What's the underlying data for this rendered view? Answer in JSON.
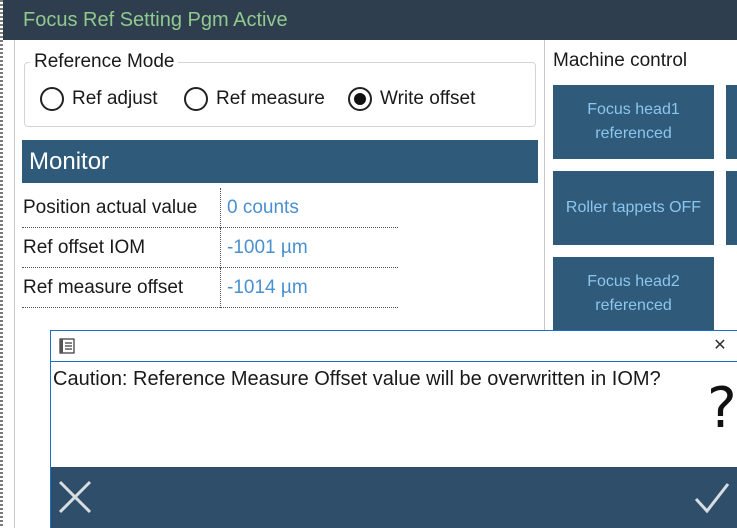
{
  "window": {
    "title": "Focus Ref Setting Pgm Active"
  },
  "reference_mode": {
    "legend": "Reference Mode",
    "options": [
      {
        "label": "Ref adjust",
        "checked": false
      },
      {
        "label": "Ref measure",
        "checked": false
      },
      {
        "label": "Write offset",
        "checked": true
      }
    ]
  },
  "monitor": {
    "title": "Monitor",
    "rows": [
      {
        "label": "Position actual value",
        "value": "0 counts"
      },
      {
        "label": "Ref offset IOM",
        "value": "-1001 µm"
      },
      {
        "label": "Ref measure offset",
        "value": "-1014 µm"
      }
    ]
  },
  "machine_control": {
    "title": "Machine control",
    "buttons": [
      {
        "label": "Focus head1 referenced"
      },
      {
        "label": "Roller tappets OFF"
      },
      {
        "label": "Focus head2 referenced"
      }
    ]
  },
  "dialog": {
    "message": "Caution: Reference Measure Offset value will be overwritten in IOM?",
    "question_glyph": "?",
    "close_glyph": "✕",
    "icons": {
      "app": "app-document-icon",
      "cancel": "cancel-x-icon",
      "ok": "checkmark-icon",
      "close": "close-icon"
    }
  },
  "colors": {
    "titlebar": "#2f3e4e",
    "title_text": "#8fc98f",
    "panel_header": "#2f5a7a",
    "value_text": "#4a90d0",
    "button_text": "#8cc6ee",
    "dialog_border": "#1a70c8",
    "dialog_footer": "#2f4e6a"
  }
}
